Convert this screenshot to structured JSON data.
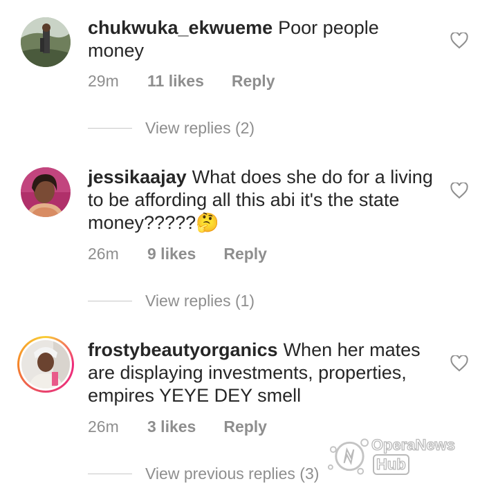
{
  "comments": [
    {
      "username": "chukwuka_ekwueme",
      "text": "Poor people money",
      "time": "29m",
      "likes": "11 likes",
      "reply": "Reply",
      "replies_label": "View replies (2)",
      "avatar_icon": "profile-photo-outdoor",
      "heart_icon": "heart-outline-icon"
    },
    {
      "username": "jessikaajay",
      "text": "What does she do for a living to be affording all this abi it's the state money?????🤔",
      "time": "26m",
      "likes": "9 likes",
      "reply": "Reply",
      "replies_label": "View replies (1)",
      "avatar_icon": "profile-photo-woman",
      "heart_icon": "heart-outline-icon"
    },
    {
      "username": "frostybeautyorganics",
      "text": "When her mates are displaying investments, properties, empires YEYE DEY smell",
      "time": "26m",
      "likes": "3 likes",
      "reply": "Reply",
      "replies_label": "View previous replies (3)",
      "avatar_icon": "profile-photo-story-ring",
      "heart_icon": "heart-outline-icon"
    }
  ],
  "watermark": {
    "brand": "OperaNews",
    "hub": "Hub"
  },
  "colors": {
    "text": "#262626",
    "secondary": "#8e8e8e",
    "divider": "#c7c7c7",
    "story_ring_start": "#f9ce34",
    "story_ring_end": "#ee2a7b"
  }
}
